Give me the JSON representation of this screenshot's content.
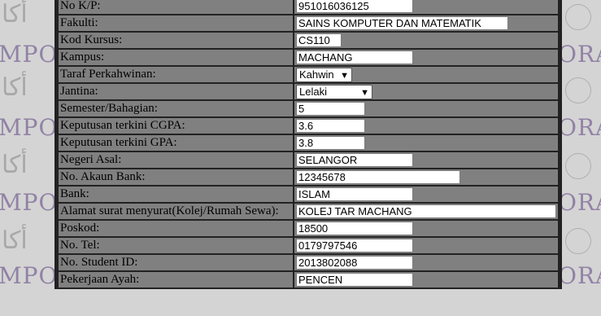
{
  "background": {
    "watermark_text": "MPORA",
    "watermark_text_right": "ORA",
    "arabic_glyph": "أكا"
  },
  "form": {
    "rows": [
      {
        "label": "No K/P:",
        "value": "951016036125",
        "type": "input"
      },
      {
        "label": "Fakulti:",
        "value": "SAINS KOMPUTER DAN MATEMATIK",
        "type": "input"
      },
      {
        "label": "Kod Kursus:",
        "value": "CS110",
        "type": "input"
      },
      {
        "label": "Kampus:",
        "value": "MACHANG",
        "type": "input"
      },
      {
        "label": "Taraf Perkahwinan:",
        "value": "Kahwin",
        "type": "select"
      },
      {
        "label": "Jantina:",
        "value": "Lelaki",
        "type": "select"
      },
      {
        "label": "Semester/Bahagian:",
        "value": "5",
        "type": "input"
      },
      {
        "label": "Keputusan terkini CGPA:",
        "value": "3.6",
        "type": "input"
      },
      {
        "label": "Keputusan terkini GPA:",
        "value": "3.8",
        "type": "input"
      },
      {
        "label": "Negeri Asal:",
        "value": "SELANGOR",
        "type": "input"
      },
      {
        "label": "No. Akaun Bank:",
        "value": "12345678",
        "type": "input"
      },
      {
        "label": "Bank:",
        "value": "ISLAM",
        "type": "input"
      },
      {
        "label": "Alamat surat menyurat(Kolej/Rumah Sewa):",
        "value": "KOLEJ TAR MACHANG",
        "type": "input"
      },
      {
        "label": "Poskod:",
        "value": "18500",
        "type": "input"
      },
      {
        "label": "No. Tel:",
        "value": "0179797546",
        "type": "input"
      },
      {
        "label": "No. Student ID:",
        "value": "2013802088",
        "type": "input"
      },
      {
        "label": "Pekerjaan Ayah:",
        "value": "PENCEN",
        "type": "input"
      }
    ]
  }
}
